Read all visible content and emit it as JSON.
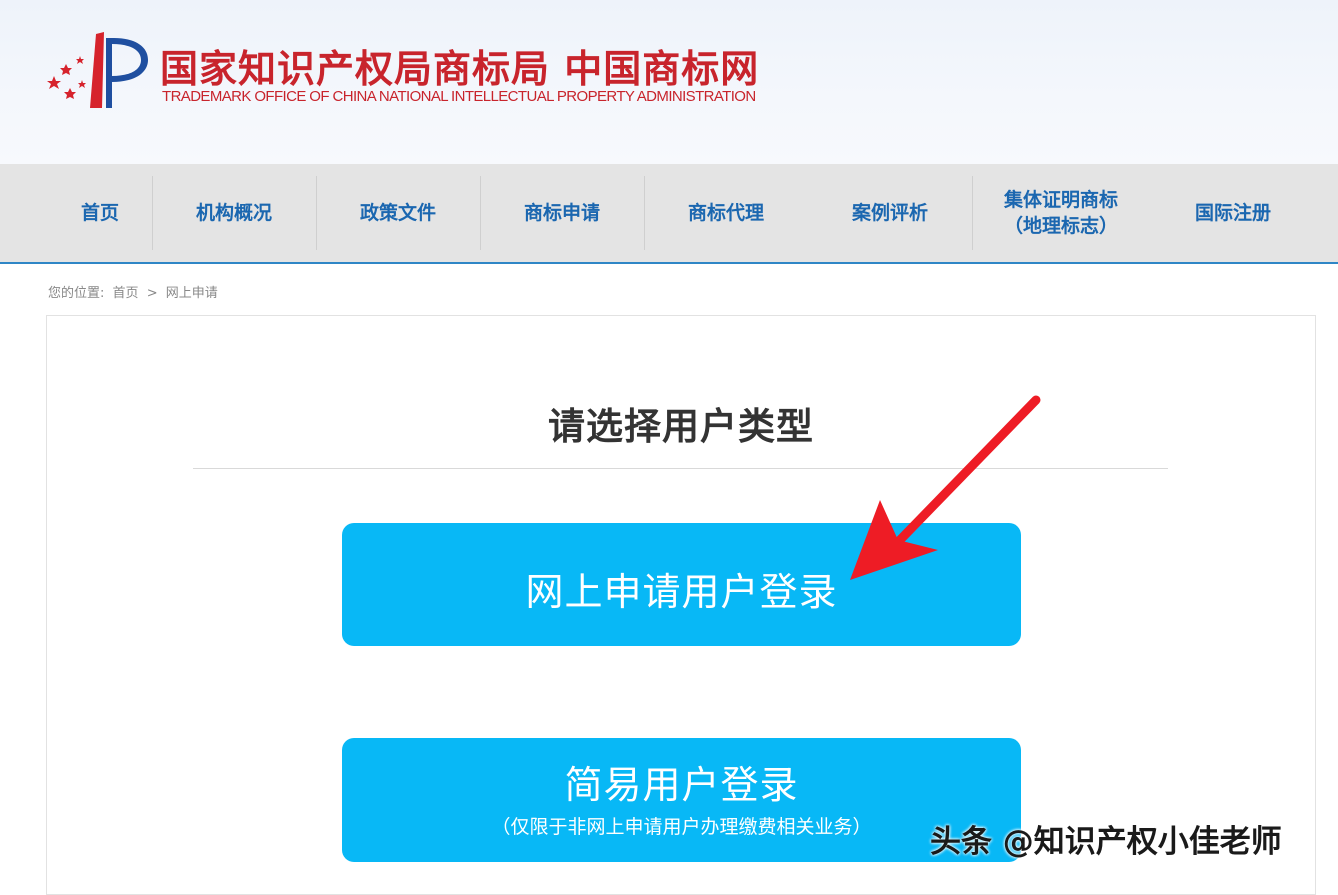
{
  "header": {
    "title_cn": "国家知识产权局商标局 中国商标网",
    "title_en": "TRADEMARK OFFICE OF CHINA NATIONAL INTELLECTUAL PROPERTY ADMINISTRATION",
    "brand_color": "#c8242c"
  },
  "nav": {
    "items": [
      {
        "label": "首页"
      },
      {
        "label": "机构概况"
      },
      {
        "label": "政策文件"
      },
      {
        "label": "商标申请"
      },
      {
        "label": "商标代理"
      },
      {
        "label": "案例评析"
      },
      {
        "label_line1": "集体证明商标",
        "label_line2": "（地理标志）"
      },
      {
        "label": "国际注册"
      }
    ],
    "text_color": "#1b67b0"
  },
  "breadcrumb": {
    "prefix": "您的位置:",
    "home": "首页",
    "separator": ">",
    "current": "网上申请"
  },
  "main": {
    "title": "请选择用户类型",
    "online_login": {
      "label": "网上申请用户登录"
    },
    "simple_login": {
      "label": "简易用户登录",
      "sub_label": "（仅限于非网上申请用户办理缴费相关业务）"
    },
    "button_color": "#08b8f6"
  },
  "watermark": {
    "text": "头条 @知识产权小佳老师"
  },
  "icons": {
    "logo": "trademark-office-logo-icon",
    "annotation": "red-arrow-icon"
  }
}
